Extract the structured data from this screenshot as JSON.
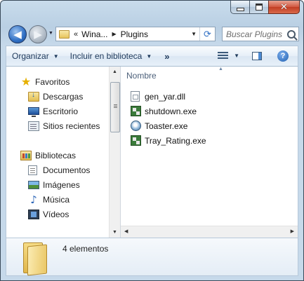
{
  "window": {
    "caption_buttons": {
      "minimize": "minimize",
      "maximize": "maximize",
      "close": "✕"
    }
  },
  "address_bar": {
    "overflow": "«",
    "crumbs": [
      "Wina...",
      "Plugins"
    ],
    "separator": "▶",
    "refresh_icon": "refresh-icon"
  },
  "search": {
    "placeholder": "Buscar Plugins"
  },
  "toolbar": {
    "organize": "Organizar",
    "include_in_library": "Incluir en biblioteca",
    "more": "»",
    "views_icon": "views-icon",
    "preview_pane_icon": "preview-pane-icon",
    "help": "?"
  },
  "navigation": {
    "favorites": {
      "label": "Favoritos",
      "items": [
        "Descargas",
        "Escritorio",
        "Sitios recientes"
      ]
    },
    "libraries": {
      "label": "Bibliotecas",
      "items": [
        "Documentos",
        "Imágenes",
        "Música",
        "Vídeos"
      ]
    }
  },
  "file_list": {
    "column_header": "Nombre",
    "files": [
      {
        "name": "gen_yar.dll",
        "icon": "dll-file-icon"
      },
      {
        "name": "shutdown.exe",
        "icon": "exe-file-icon"
      },
      {
        "name": "Toaster.exe",
        "icon": "toaster-app-icon"
      },
      {
        "name": "Tray_Rating.exe",
        "icon": "exe-file-icon"
      }
    ]
  },
  "details_pane": {
    "item_count": "4 elementos"
  },
  "colors": {
    "window_frame": "#b9cfe3",
    "command_text": "#1e395b",
    "header_text": "#4c607a",
    "close_button": "#c13d24"
  }
}
